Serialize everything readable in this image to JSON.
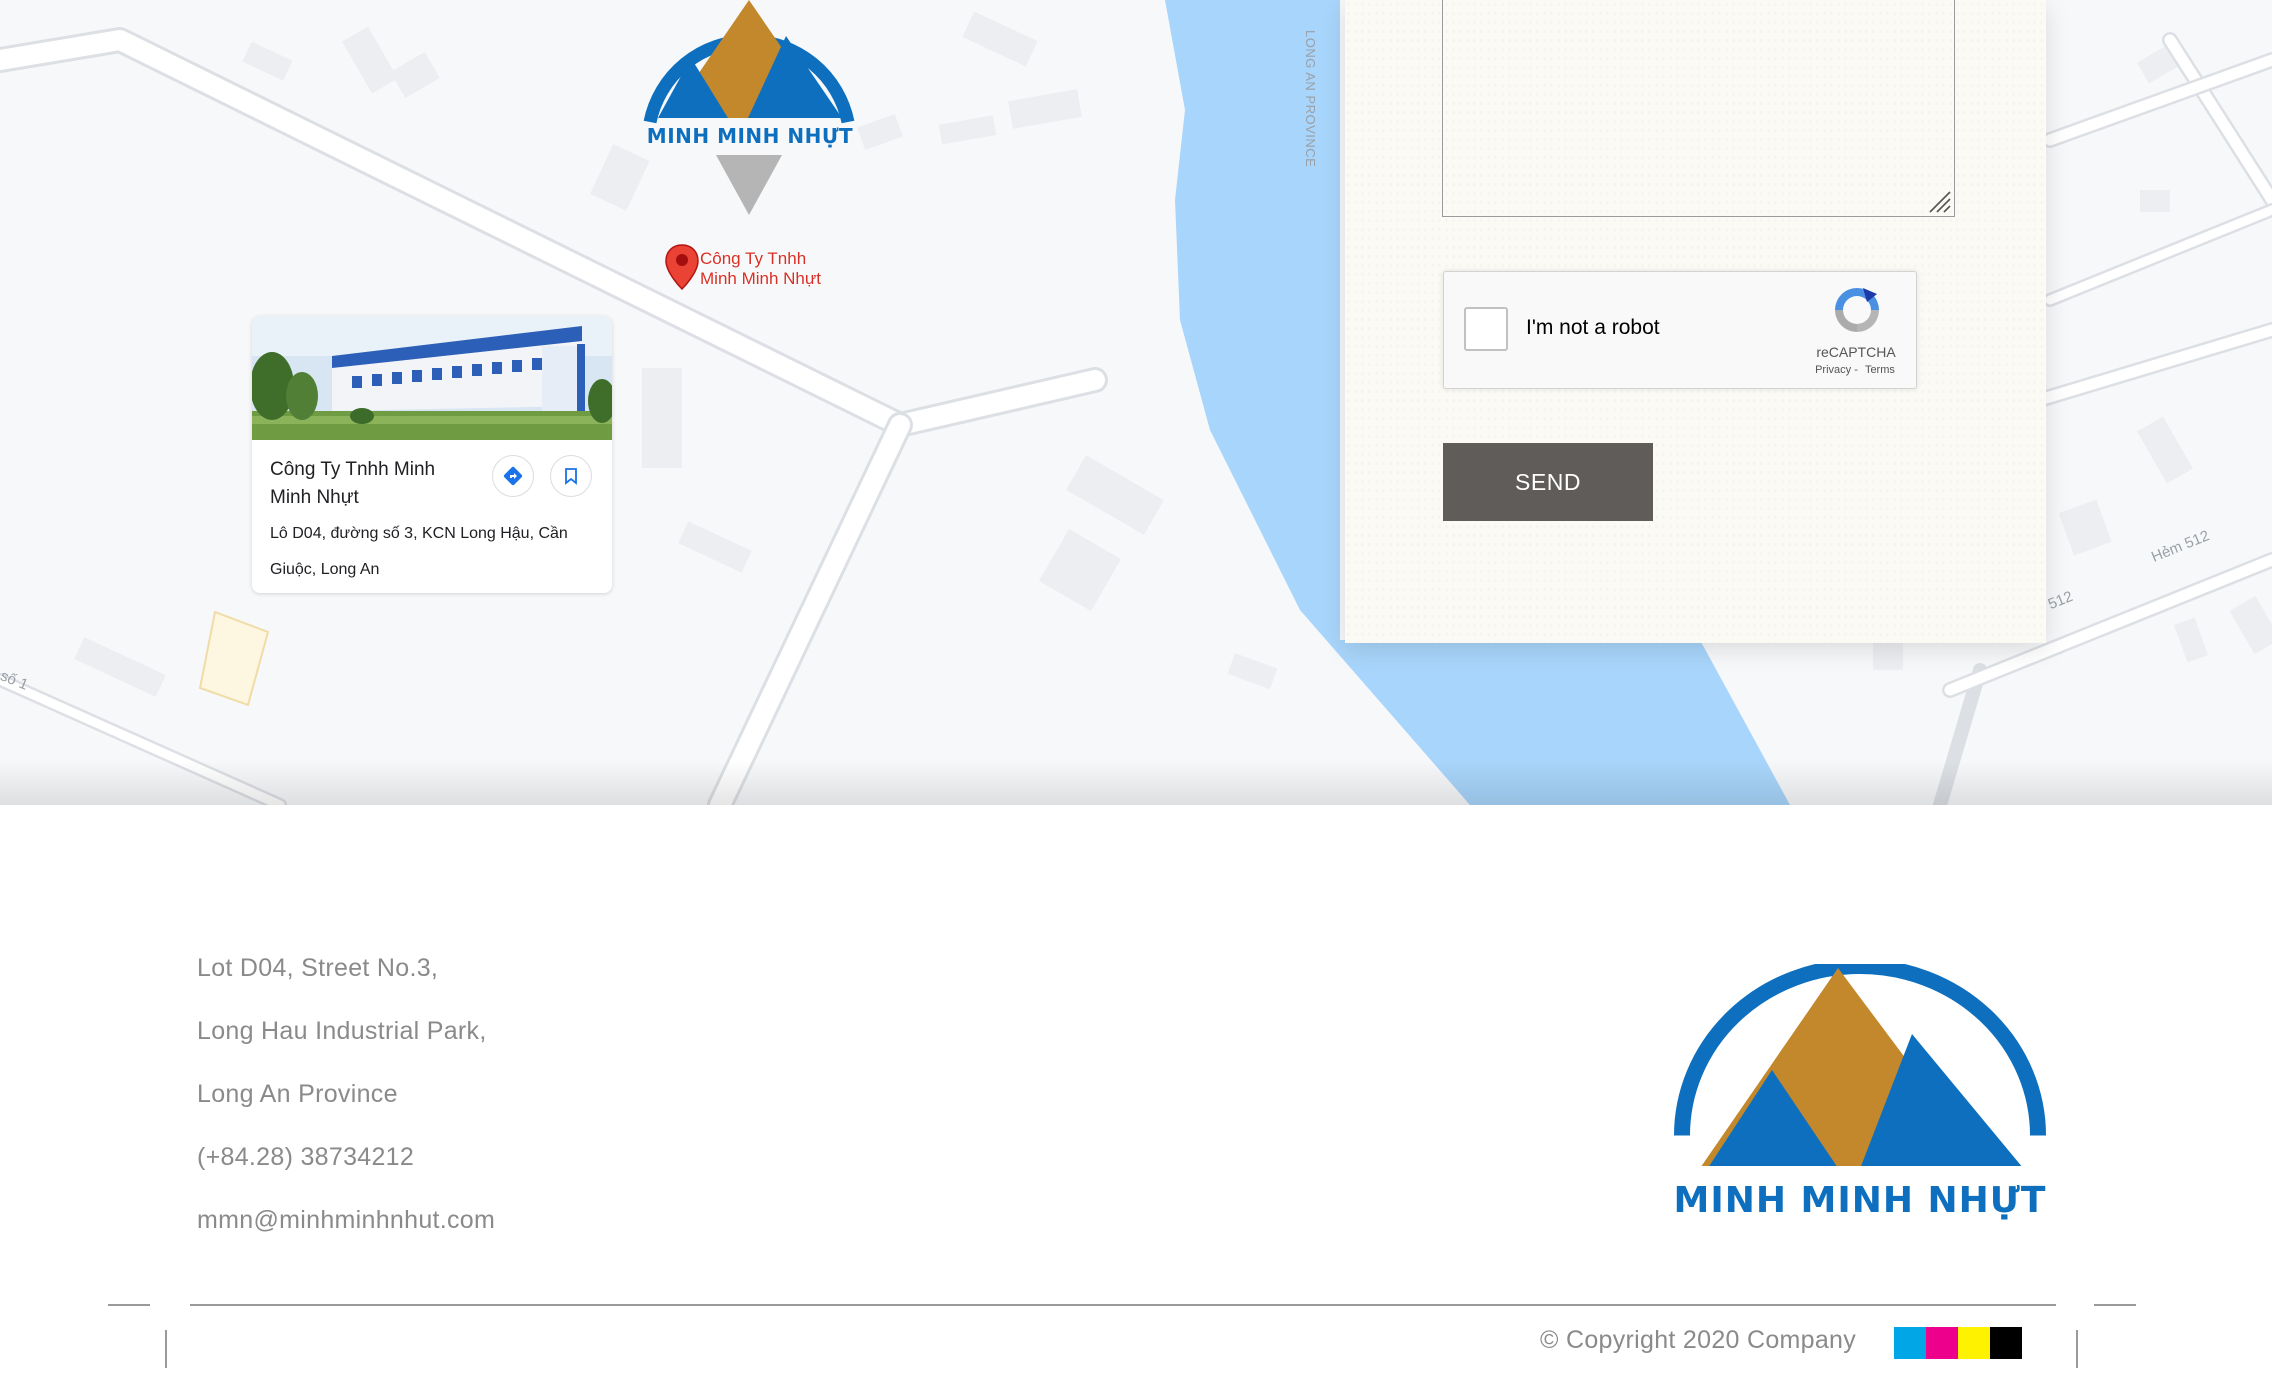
{
  "map": {
    "pin_label_line1": "Công Ty Tnhh",
    "pin_label_line2": "Minh Minh Nhựt",
    "street_labels": [
      "LONG AN PROVINCE",
      "Hẻm 512",
      "512",
      "số 1"
    ],
    "place_card": {
      "name": "Công Ty Tnhh Minh Minh Nhựt",
      "address": "Lô D04, đường số 3, KCN Long Hậu, Cần Giuộc, Long An",
      "directions_icon": "directions-icon",
      "save_icon": "bookmark-icon"
    }
  },
  "brand": {
    "logo_text": "MINH MINH NHỰT",
    "colors": {
      "blue": "#0e6fbf",
      "gold": "#c2882b",
      "gray": "#b5b5b5"
    }
  },
  "contact_form": {
    "recaptcha": {
      "label": "I'm not a robot",
      "brand": "reCAPTCHA",
      "privacy": "Privacy",
      "separator": " - ",
      "terms": "Terms"
    },
    "send_label": "SEND",
    "send_color": "#5f5c59"
  },
  "footer": {
    "address_lines": [
      "Lot D04, Street No.3,",
      "Long Hau Industrial Park,",
      "Long An Province"
    ],
    "phone": "(+84.28) 38734212",
    "email": "mmn@minhminhnhut.com",
    "copyright": "© Copyright 2020 Company",
    "swatch_colors": [
      "#00a6e6",
      "#ec008c",
      "#fff200",
      "#000000"
    ]
  }
}
